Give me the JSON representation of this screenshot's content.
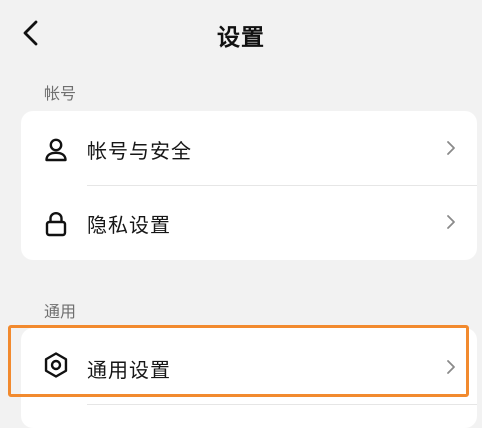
{
  "header": {
    "title": "设置",
    "back_icon": "chevron-left-icon"
  },
  "sections": [
    {
      "label": "帐号",
      "items": [
        {
          "label": "帐号与安全",
          "icon": "user-icon"
        },
        {
          "label": "隐私设置",
          "icon": "lock-icon"
        }
      ]
    },
    {
      "label": "通用",
      "items": [
        {
          "label": "通用设置",
          "icon": "gear-icon"
        }
      ]
    }
  ],
  "colors": {
    "background": "#f2f2f2",
    "card": "#ffffff",
    "highlight": "#f28a2e",
    "section_label": "#6f6f6f"
  }
}
